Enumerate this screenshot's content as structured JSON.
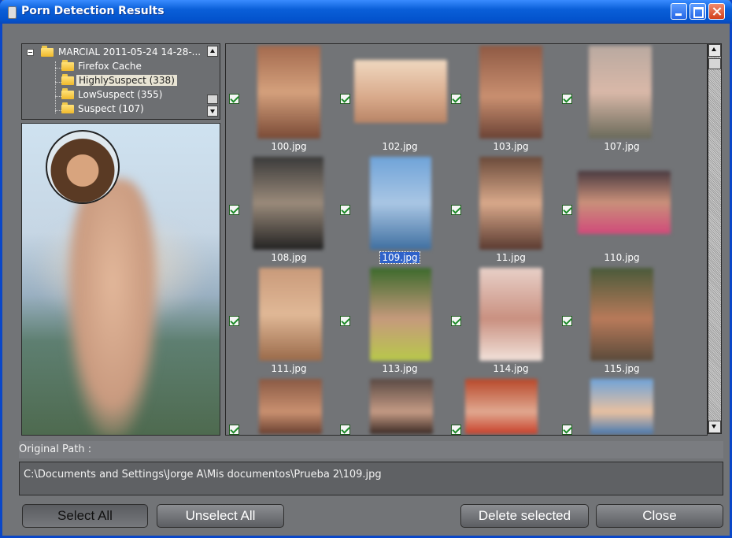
{
  "window": {
    "title": "Porn Detection Results"
  },
  "tree": {
    "root": "MARCIAL 2011-05-24 14-28-...",
    "items": [
      {
        "label": "Firefox Cache",
        "selected": false
      },
      {
        "label": "HighlySuspect (338)",
        "selected": true
      },
      {
        "label": "LowSuspect (355)",
        "selected": false
      },
      {
        "label": "Suspect (107)",
        "selected": false
      }
    ]
  },
  "thumbnails": [
    {
      "file": "100.jpg",
      "checked": true,
      "selected": false
    },
    {
      "file": "102.jpg",
      "checked": true,
      "selected": false
    },
    {
      "file": "103.jpg",
      "checked": true,
      "selected": false
    },
    {
      "file": "107.jpg",
      "checked": true,
      "selected": false
    },
    {
      "file": "108.jpg",
      "checked": true,
      "selected": false
    },
    {
      "file": "109.jpg",
      "checked": true,
      "selected": true
    },
    {
      "file": "11.jpg",
      "checked": true,
      "selected": false
    },
    {
      "file": "110.jpg",
      "checked": true,
      "selected": false
    },
    {
      "file": "111.jpg",
      "checked": true,
      "selected": false
    },
    {
      "file": "113.jpg",
      "checked": true,
      "selected": false
    },
    {
      "file": "114.jpg",
      "checked": true,
      "selected": false
    },
    {
      "file": "115.jpg",
      "checked": true,
      "selected": false
    },
    {
      "file": "",
      "checked": true,
      "selected": false
    },
    {
      "file": "",
      "checked": true,
      "selected": false
    },
    {
      "file": "",
      "checked": true,
      "selected": false
    },
    {
      "file": "",
      "checked": true,
      "selected": false
    }
  ],
  "path": {
    "label": "Original Path :",
    "value": "C:\\Documents and Settings\\Jorge A\\Mis documentos\\Prueba 2\\109.jpg"
  },
  "buttons": {
    "select_all": "Select All",
    "unselect_all": "Unselect All",
    "delete_selected": "Delete selected",
    "close": "Close"
  }
}
